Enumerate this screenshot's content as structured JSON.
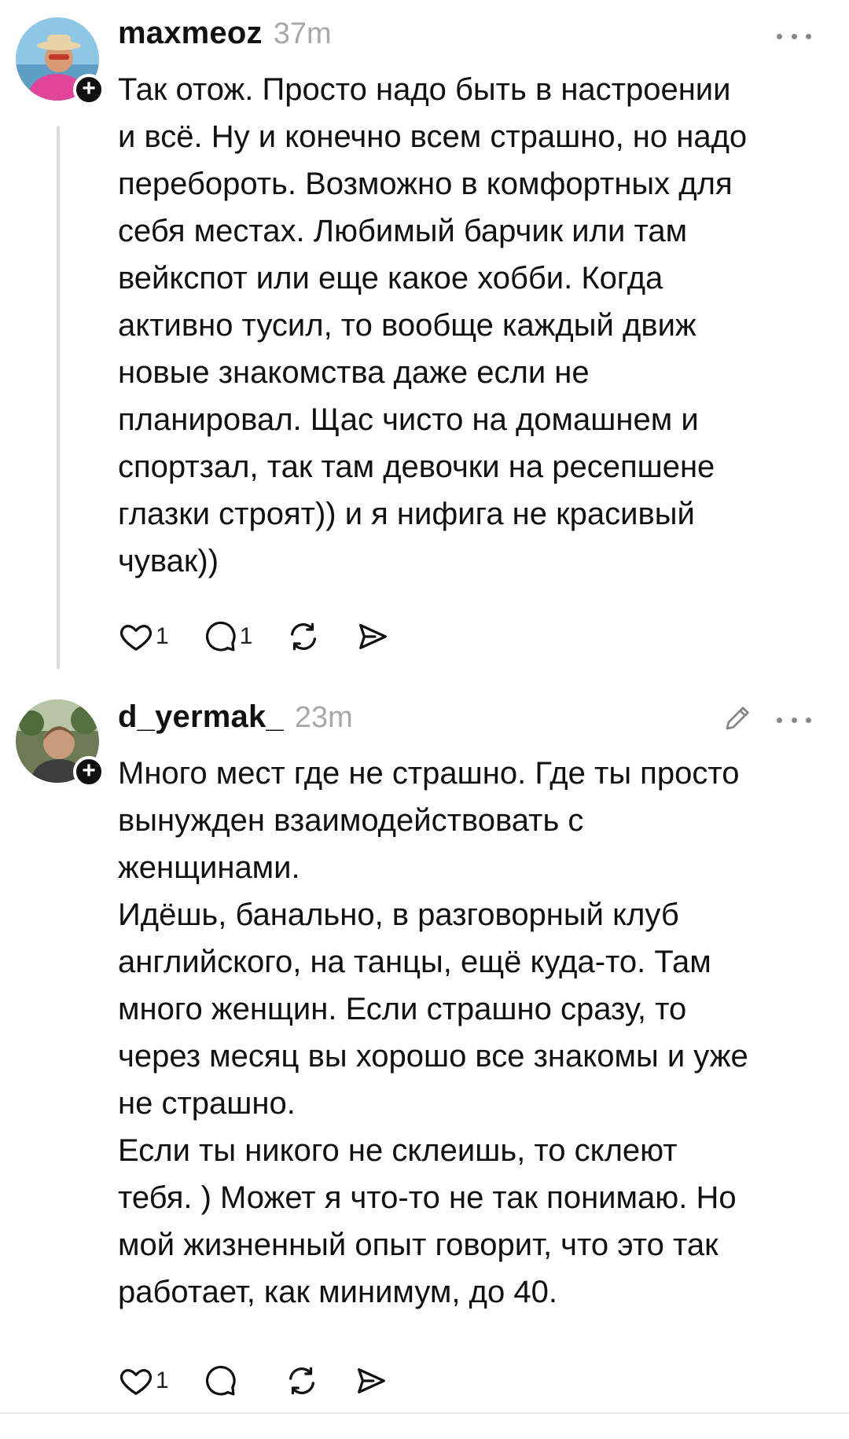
{
  "posts": [
    {
      "username": "maxmeoz",
      "time": "37m",
      "lines": [
        "Так отож. Просто надо быть в настроении",
        "и всё. Ну и конечно всем страшно, но надо",
        "перебороть. Возможно в комфортных для",
        "себя местах. Любимый барчик или там",
        "вейкспот или еще какое хобби. Когда",
        "активно тусил, то вообще каждый движ",
        "новые знакомства даже если не",
        "планировал. Щас чисто на домашнем и",
        "спортзал, так там девочки на ресепшене",
        "глазки строят)) и я нифига не красивый",
        "чувак))"
      ],
      "likes": "1",
      "replies": "1",
      "reposts": "",
      "avatar_colors": {
        "sky": "#8ec6e6",
        "shirt": "#e0459b",
        "hat": "#e8d3a8",
        "face": "#d99a76"
      }
    },
    {
      "username": "d_yermak_",
      "time": "23m",
      "lines": [
        "Много мест где не страшно. Где ты просто",
        "вынужден взаимодействовать с",
        "женщинами.",
        "Идёшь, банально, в разговорный клуб",
        "английского, на танцы, ещё куда-то. Там",
        "много женщин. Если страшно сразу, то",
        "через месяц вы хорошо все знакомы и уже",
        "не страшно.",
        "Если ты никого не склеишь, то склеют",
        "тебя. ) Может я что-то не так понимаю. Но",
        "мой жизненный опыт говорит, что это так",
        "работает, как минимум, до 40."
      ],
      "likes": "1",
      "replies": "",
      "reposts": "",
      "avatar_colors": {
        "bg": "#6c7a55",
        "face": "#c99a7c",
        "shirt": "#3d3d3d"
      }
    }
  ],
  "icons": {
    "like": "heart-icon",
    "reply": "comment-icon",
    "repost": "repost-icon",
    "share": "send-icon",
    "more": "more-icon",
    "edit": "pencil-icon",
    "follow": "plus-icon"
  }
}
